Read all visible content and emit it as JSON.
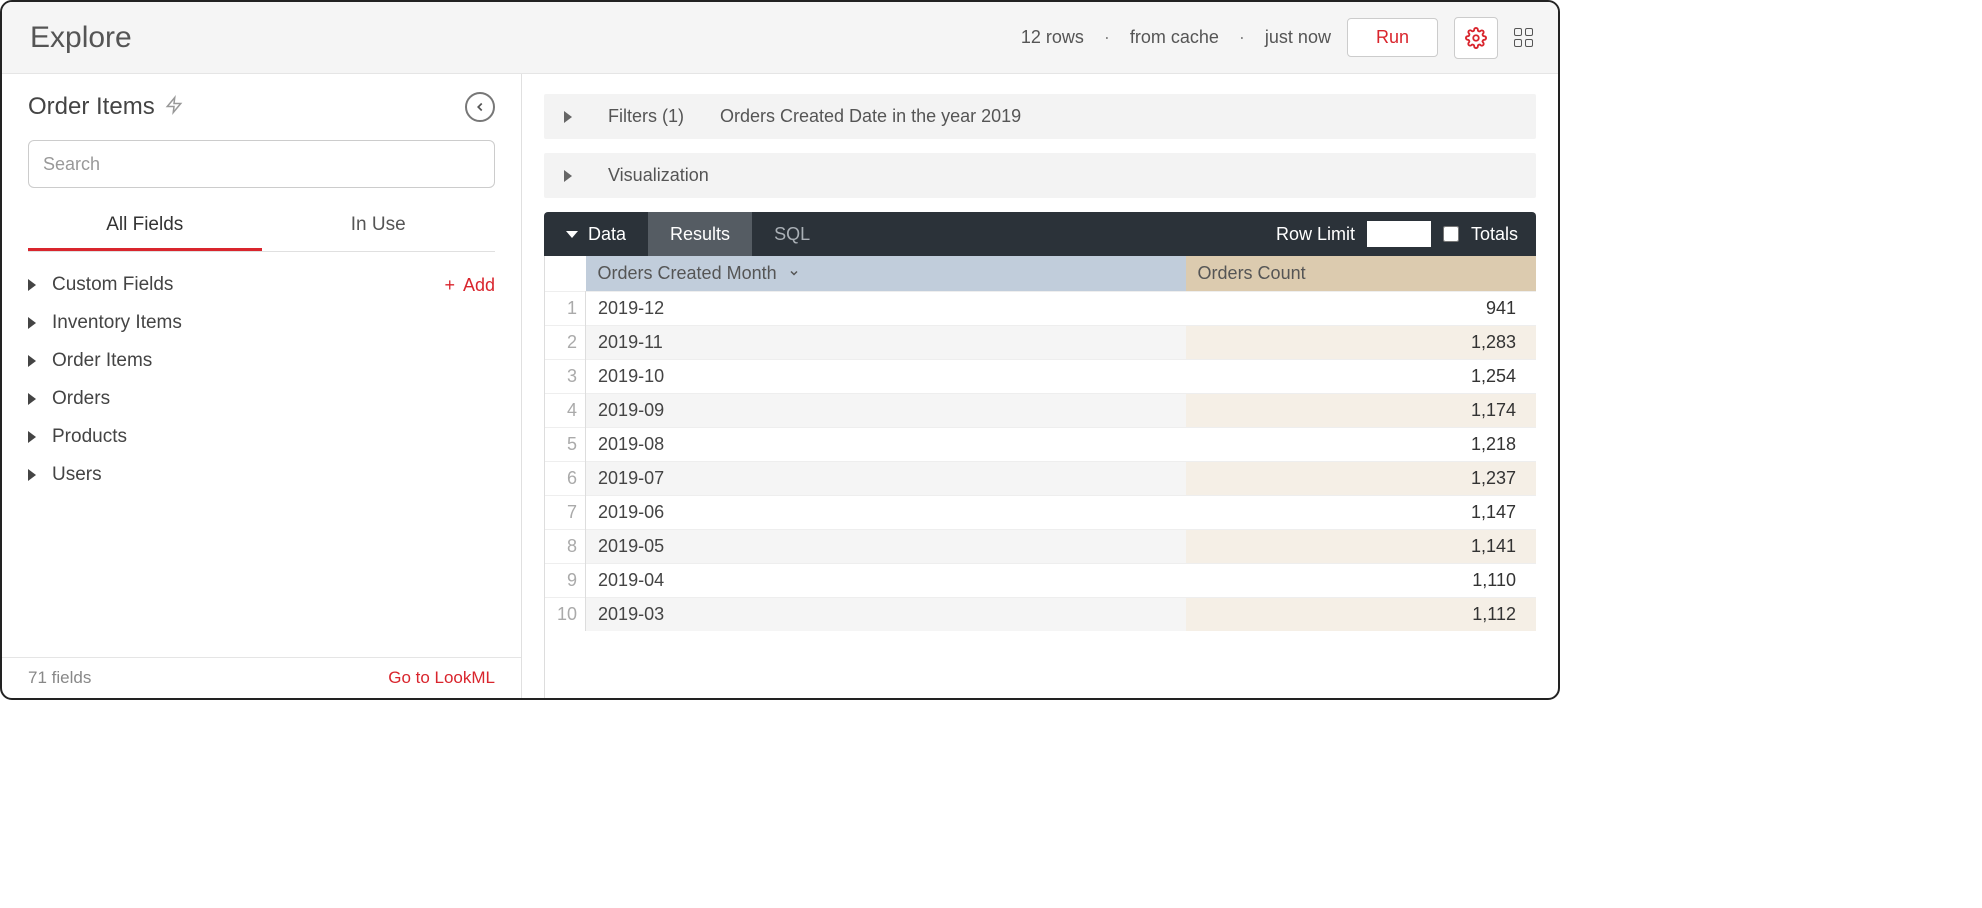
{
  "header": {
    "title": "Explore",
    "rows_text": "12 rows",
    "cache_text": "from cache",
    "time_text": "just now",
    "run_label": "Run"
  },
  "sidebar": {
    "title": "Order Items",
    "search_placeholder": "Search",
    "tabs": {
      "all": "All Fields",
      "inuse": "In Use"
    },
    "add_label": "Add",
    "fields": [
      "Custom Fields",
      "Inventory Items",
      "Order Items",
      "Orders",
      "Products",
      "Users"
    ],
    "footer_count": "71 fields",
    "lookml_label": "Go to LookML"
  },
  "panels": {
    "filters_label": "Filters (1)",
    "filters_desc": "Orders Created Date in the year 2019",
    "viz_label": "Visualization"
  },
  "databar": {
    "data": "Data",
    "results": "Results",
    "sql": "SQL",
    "row_limit_label": "Row Limit",
    "row_limit_value": "",
    "totals_label": "Totals"
  },
  "table": {
    "dim_header": "Orders Created Month",
    "meas_header": "Orders Count",
    "rows": [
      {
        "n": "1",
        "month": "2019-12",
        "count": "941"
      },
      {
        "n": "2",
        "month": "2019-11",
        "count": "1,283"
      },
      {
        "n": "3",
        "month": "2019-10",
        "count": "1,254"
      },
      {
        "n": "4",
        "month": "2019-09",
        "count": "1,174"
      },
      {
        "n": "5",
        "month": "2019-08",
        "count": "1,218"
      },
      {
        "n": "6",
        "month": "2019-07",
        "count": "1,237"
      },
      {
        "n": "7",
        "month": "2019-06",
        "count": "1,147"
      },
      {
        "n": "8",
        "month": "2019-05",
        "count": "1,141"
      },
      {
        "n": "9",
        "month": "2019-04",
        "count": "1,110"
      },
      {
        "n": "10",
        "month": "2019-03",
        "count": "1,112"
      }
    ]
  }
}
